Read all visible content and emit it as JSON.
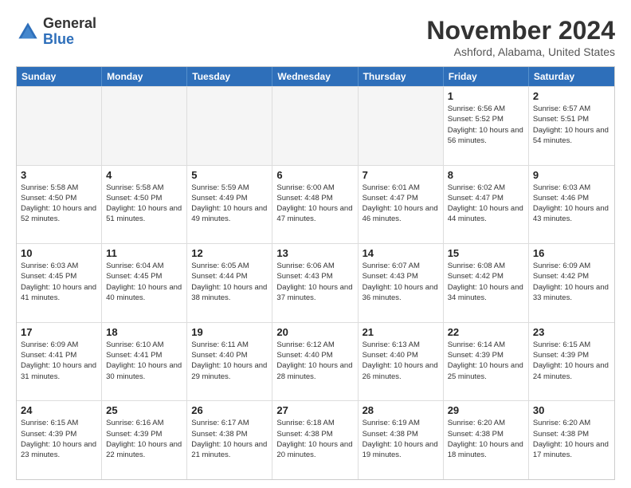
{
  "header": {
    "logo_general": "General",
    "logo_blue": "Blue",
    "month_title": "November 2024",
    "location": "Ashford, Alabama, United States"
  },
  "days_of_week": [
    "Sunday",
    "Monday",
    "Tuesday",
    "Wednesday",
    "Thursday",
    "Friday",
    "Saturday"
  ],
  "weeks": [
    [
      {
        "day": "",
        "info": ""
      },
      {
        "day": "",
        "info": ""
      },
      {
        "day": "",
        "info": ""
      },
      {
        "day": "",
        "info": ""
      },
      {
        "day": "",
        "info": ""
      },
      {
        "day": "1",
        "info": "Sunrise: 6:56 AM\nSunset: 5:52 PM\nDaylight: 10 hours\nand 56 minutes."
      },
      {
        "day": "2",
        "info": "Sunrise: 6:57 AM\nSunset: 5:51 PM\nDaylight: 10 hours\nand 54 minutes."
      }
    ],
    [
      {
        "day": "3",
        "info": "Sunrise: 5:58 AM\nSunset: 4:50 PM\nDaylight: 10 hours\nand 52 minutes."
      },
      {
        "day": "4",
        "info": "Sunrise: 5:58 AM\nSunset: 4:50 PM\nDaylight: 10 hours\nand 51 minutes."
      },
      {
        "day": "5",
        "info": "Sunrise: 5:59 AM\nSunset: 4:49 PM\nDaylight: 10 hours\nand 49 minutes."
      },
      {
        "day": "6",
        "info": "Sunrise: 6:00 AM\nSunset: 4:48 PM\nDaylight: 10 hours\nand 47 minutes."
      },
      {
        "day": "7",
        "info": "Sunrise: 6:01 AM\nSunset: 4:47 PM\nDaylight: 10 hours\nand 46 minutes."
      },
      {
        "day": "8",
        "info": "Sunrise: 6:02 AM\nSunset: 4:47 PM\nDaylight: 10 hours\nand 44 minutes."
      },
      {
        "day": "9",
        "info": "Sunrise: 6:03 AM\nSunset: 4:46 PM\nDaylight: 10 hours\nand 43 minutes."
      }
    ],
    [
      {
        "day": "10",
        "info": "Sunrise: 6:03 AM\nSunset: 4:45 PM\nDaylight: 10 hours\nand 41 minutes."
      },
      {
        "day": "11",
        "info": "Sunrise: 6:04 AM\nSunset: 4:45 PM\nDaylight: 10 hours\nand 40 minutes."
      },
      {
        "day": "12",
        "info": "Sunrise: 6:05 AM\nSunset: 4:44 PM\nDaylight: 10 hours\nand 38 minutes."
      },
      {
        "day": "13",
        "info": "Sunrise: 6:06 AM\nSunset: 4:43 PM\nDaylight: 10 hours\nand 37 minutes."
      },
      {
        "day": "14",
        "info": "Sunrise: 6:07 AM\nSunset: 4:43 PM\nDaylight: 10 hours\nand 36 minutes."
      },
      {
        "day": "15",
        "info": "Sunrise: 6:08 AM\nSunset: 4:42 PM\nDaylight: 10 hours\nand 34 minutes."
      },
      {
        "day": "16",
        "info": "Sunrise: 6:09 AM\nSunset: 4:42 PM\nDaylight: 10 hours\nand 33 minutes."
      }
    ],
    [
      {
        "day": "17",
        "info": "Sunrise: 6:09 AM\nSunset: 4:41 PM\nDaylight: 10 hours\nand 31 minutes."
      },
      {
        "day": "18",
        "info": "Sunrise: 6:10 AM\nSunset: 4:41 PM\nDaylight: 10 hours\nand 30 minutes."
      },
      {
        "day": "19",
        "info": "Sunrise: 6:11 AM\nSunset: 4:40 PM\nDaylight: 10 hours\nand 29 minutes."
      },
      {
        "day": "20",
        "info": "Sunrise: 6:12 AM\nSunset: 4:40 PM\nDaylight: 10 hours\nand 28 minutes."
      },
      {
        "day": "21",
        "info": "Sunrise: 6:13 AM\nSunset: 4:40 PM\nDaylight: 10 hours\nand 26 minutes."
      },
      {
        "day": "22",
        "info": "Sunrise: 6:14 AM\nSunset: 4:39 PM\nDaylight: 10 hours\nand 25 minutes."
      },
      {
        "day": "23",
        "info": "Sunrise: 6:15 AM\nSunset: 4:39 PM\nDaylight: 10 hours\nand 24 minutes."
      }
    ],
    [
      {
        "day": "24",
        "info": "Sunrise: 6:15 AM\nSunset: 4:39 PM\nDaylight: 10 hours\nand 23 minutes."
      },
      {
        "day": "25",
        "info": "Sunrise: 6:16 AM\nSunset: 4:39 PM\nDaylight: 10 hours\nand 22 minutes."
      },
      {
        "day": "26",
        "info": "Sunrise: 6:17 AM\nSunset: 4:38 PM\nDaylight: 10 hours\nand 21 minutes."
      },
      {
        "day": "27",
        "info": "Sunrise: 6:18 AM\nSunset: 4:38 PM\nDaylight: 10 hours\nand 20 minutes."
      },
      {
        "day": "28",
        "info": "Sunrise: 6:19 AM\nSunset: 4:38 PM\nDaylight: 10 hours\nand 19 minutes."
      },
      {
        "day": "29",
        "info": "Sunrise: 6:20 AM\nSunset: 4:38 PM\nDaylight: 10 hours\nand 18 minutes."
      },
      {
        "day": "30",
        "info": "Sunrise: 6:20 AM\nSunset: 4:38 PM\nDaylight: 10 hours\nand 17 minutes."
      }
    ]
  ]
}
